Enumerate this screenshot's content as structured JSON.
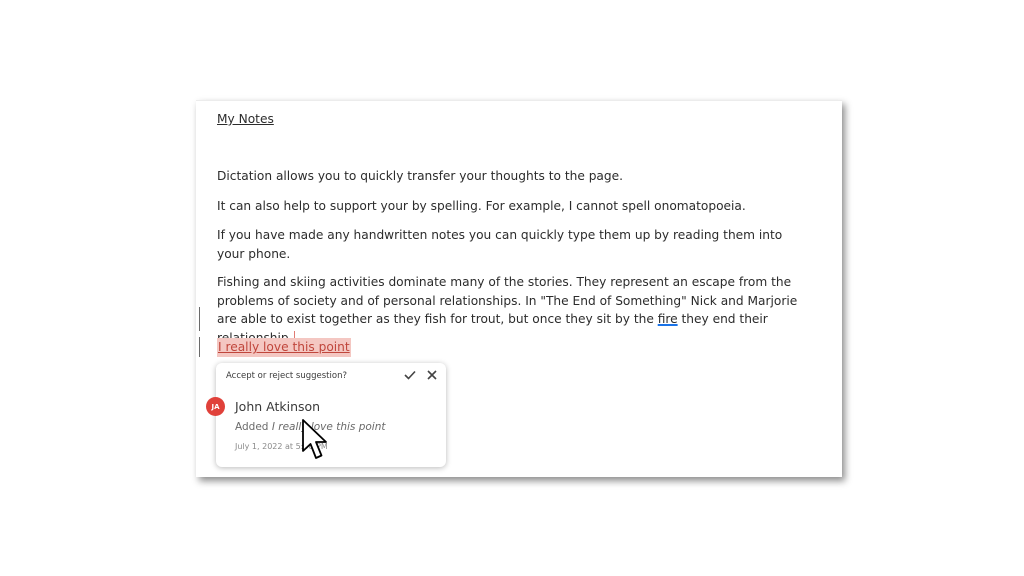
{
  "document": {
    "title": "My Notes",
    "paragraphs": [
      "Dictation allows you to quickly transfer your thoughts to the page.",
      "It can also help to support your by spelling. For example, I cannot spell onomatopoeia.",
      "If you have made any handwritten notes you can quickly type them up by reading them into your phone."
    ],
    "paragraph4": {
      "before": "Fishing and skiing activities dominate many of the stories. They represent an escape from the problems of society and of personal relationships. In \"The End of Something\" Nick and Marjorie are able to exist together as they fish for trout, but once they sit by the ",
      "link_word": "fire",
      "after": " they end their relationship."
    },
    "suggested_text": "I really love this point"
  },
  "suggestion_card": {
    "header": "Accept or reject suggestion?",
    "accept_icon": "check-icon",
    "reject_icon": "close-icon",
    "avatar_initials": "JA",
    "author": "John Atkinson",
    "action_prefix": "Added",
    "action_text": "I really love this point",
    "timestamp": "July 1, 2022 at 5:30 PM"
  },
  "colors": {
    "suggestion_highlight": "#f4c7c2",
    "suggestion_text": "#c0463c",
    "avatar": "#e0413a",
    "link_underline": "#1a73e8"
  }
}
